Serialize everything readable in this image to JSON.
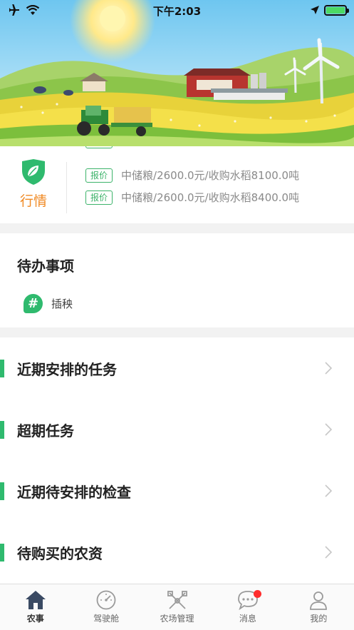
{
  "status_bar": {
    "time": "下午2:03"
  },
  "quote": {
    "logo_label": "行情",
    "rows": [
      {
        "tag": "报价",
        "text": "中储粮/2600.0元/收购水稻8100.0吨"
      },
      {
        "tag": "报价",
        "text": "中储粮/2600.0元/收购水稻8400.0吨"
      }
    ]
  },
  "todo": {
    "title": "待办事项",
    "items": [
      {
        "icon": "hash-icon",
        "label": "插秧"
      }
    ]
  },
  "sections": [
    {
      "label": "近期安排的任务"
    },
    {
      "label": "超期任务"
    },
    {
      "label": "近期待安排的检查"
    },
    {
      "label": "待购买的农资"
    }
  ],
  "tabbar": {
    "tabs": [
      {
        "label": "农事",
        "icon": "home-icon",
        "active": true
      },
      {
        "label": "驾驶舱",
        "icon": "gauge-icon",
        "active": false
      },
      {
        "label": "农场管理",
        "icon": "tools-icon",
        "active": false
      },
      {
        "label": "消息",
        "icon": "message-icon",
        "active": false,
        "badge": true
      },
      {
        "label": "我的",
        "icon": "user-icon",
        "active": false
      }
    ]
  },
  "colors": {
    "accent": "#2fba6e",
    "orange": "#f08a24",
    "badge": "#ff2d2d"
  }
}
